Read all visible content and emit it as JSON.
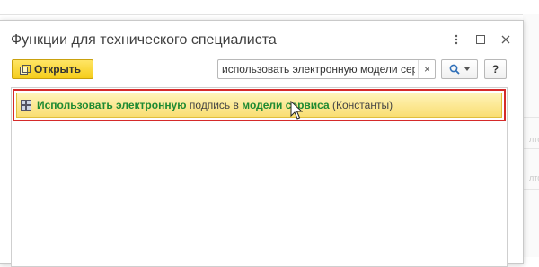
{
  "dialog": {
    "title": "Функции для технического специалиста"
  },
  "window_controls": {
    "more_icon": "vertical-ellipsis",
    "maximize_icon": "square",
    "close_icon": "x"
  },
  "toolbar": {
    "open_label": "Открыть",
    "search_value": "использовать электронную модели сер",
    "search_clear": "×",
    "find_icon": "magnifier",
    "help_label": "?"
  },
  "list": {
    "rows": [
      {
        "segments": [
          {
            "text": "Использовать электронную",
            "highlight": true
          },
          {
            "text": " подпись в ",
            "highlight": false
          },
          {
            "text": "модели сервиса",
            "highlight": true
          },
          {
            "text": " (Константы)",
            "highlight": false
          }
        ]
      }
    ]
  },
  "background": {
    "fragments": [
      "",
      "лто",
      "лто"
    ]
  },
  "colors": {
    "accent_yellow": "#f5cd1a",
    "highlight_green": "#1e8a33",
    "selection_border": "#d52a2a",
    "find_blue": "#2f6fb8"
  }
}
